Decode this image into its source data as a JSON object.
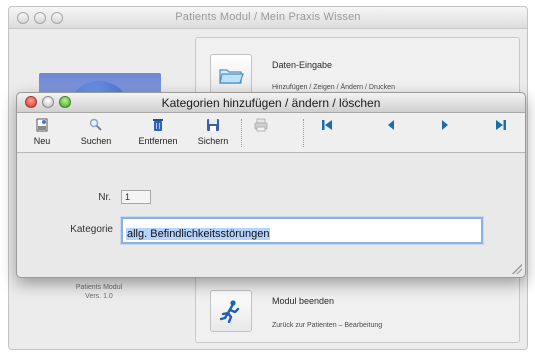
{
  "back_window": {
    "title": "Patients Modul  / Mein Praxis Wissen",
    "app_info": [
      "Patients Modul",
      "Vers. 1.0"
    ],
    "entries": [
      {
        "title": "Daten-Eingabe",
        "subtitle": "Hinzufügen / Zeigen / Ändern / Drucken",
        "icon": "folder-icon"
      },
      {
        "title": "Modul beenden",
        "subtitle": "Zurück zur Patienten – Bearbeitung",
        "icon": "running-man-icon"
      }
    ]
  },
  "dialog": {
    "title": "Kategorien hinzufügen / ändern / löschen",
    "toolbar": {
      "new_label": "Neu",
      "search_label": "Suchen",
      "remove_label": "Entfernen",
      "save_label": "Sichern"
    },
    "form": {
      "nr_label": "Nr.",
      "nr_value": "1",
      "category_label": "Kategorie",
      "category_value": "allg. Befindlichkeitsstörungen"
    }
  },
  "colors": {
    "selection": "#b5d3ff",
    "nav_arrows": "#1b6ea8",
    "close_red": "#d8382b",
    "zoom_green": "#3fa52a"
  }
}
